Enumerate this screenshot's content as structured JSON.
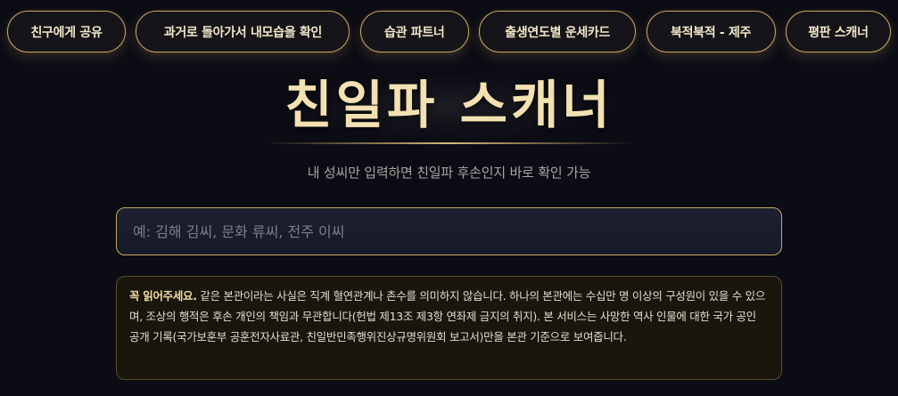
{
  "nav": {
    "items": [
      {
        "label": "친구에게 공유"
      },
      {
        "label": "과거로 돌아가서 내모습을 확인"
      },
      {
        "label": "습관 파트너"
      },
      {
        "label": "출생연도별 운세카드"
      },
      {
        "label": "북적북적 - 제주"
      },
      {
        "label": "평판 스캐너"
      }
    ]
  },
  "header": {
    "title": "친일파 스캐너",
    "subtitle": "내 성씨만 입력하면 친일파 후손인지 바로 확인 가능"
  },
  "search": {
    "value": "",
    "placeholder": "예: 김해 김씨, 문화 류씨, 전주 이씨"
  },
  "notice": {
    "lead": "꼭 읽어주세요.",
    "body": " 같은 본관이라는 사실은 직계 혈연관계나 촌수를 의미하지 않습니다. 하나의 본관에는 수십만 명 이상의 구성원이 있을 수 있으며, 조상의 행적은 후손 개인의 책임과 무관합니다(헌법 제13조 제3항 연좌제 금지의 취지). 본 서비스는 사망한 역사 인물에 대한 국가 공인 공개 기록(국가보훈부 공훈전자사료관, 친일반민족행위진상규명위원회 보고서)만을 본관 기준으로 보여줍니다."
  },
  "colors": {
    "background": "#0b0c14",
    "accent_gold": "#c9a866",
    "title_gold": "#f3e1b2",
    "notice_bg": "#19160e"
  }
}
